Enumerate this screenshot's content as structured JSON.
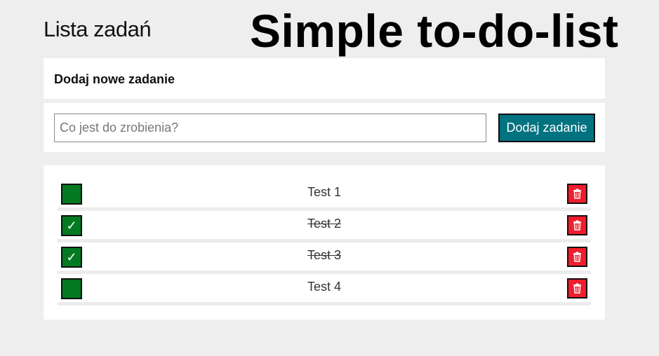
{
  "header": {
    "title": "Lista zadań",
    "hero": "Simple to-do-list"
  },
  "new_task": {
    "heading": "Dodaj nowe zadanie",
    "placeholder": "Co jest do zrobienia?",
    "value": "",
    "button_label": "Dodaj zadanie"
  },
  "colors": {
    "accent": "#007280",
    "done_toggle": "#027a21",
    "delete": "#f21c2c",
    "background": "#eeeeee"
  },
  "tasks": [
    {
      "text": "Test 1",
      "done": false,
      "check_mark": "",
      "delete_icon": "trash-icon"
    },
    {
      "text": "Test 2",
      "done": true,
      "check_mark": "✓",
      "delete_icon": "trash-icon"
    },
    {
      "text": "Test 3",
      "done": true,
      "check_mark": "✓",
      "delete_icon": "trash-icon"
    },
    {
      "text": "Test 4",
      "done": false,
      "check_mark": "",
      "delete_icon": "trash-icon"
    }
  ]
}
